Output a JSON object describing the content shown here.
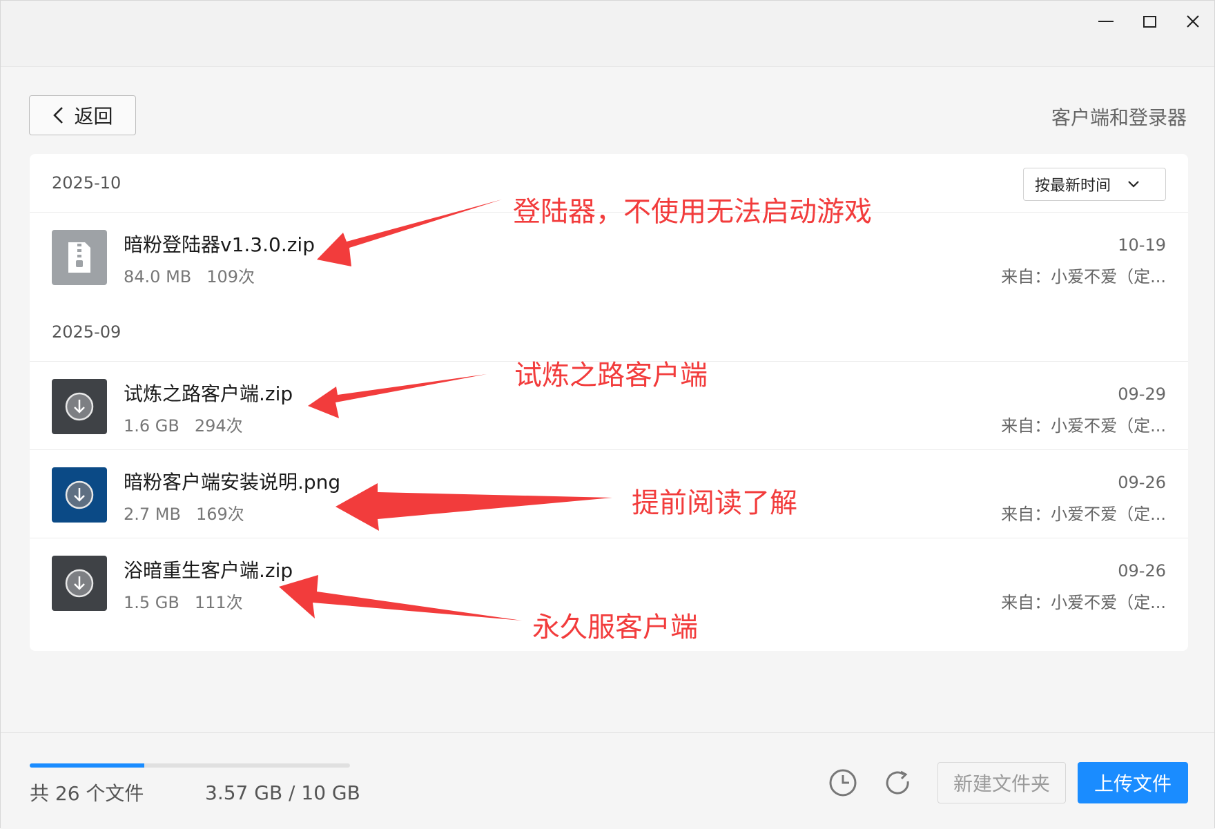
{
  "header": {
    "back_label": "返回",
    "folder_title": "客户端和登录器"
  },
  "sort": {
    "label": "按最新时间"
  },
  "groups": [
    {
      "month": "2025-10"
    },
    {
      "month": "2025-09"
    }
  ],
  "files": [
    {
      "name": "暗粉登陆器v1.3.0.zip",
      "size": "84.0 MB",
      "downloads": "109次",
      "date": "10-19",
      "from": "来自：小爱不爱（定...",
      "icon": "zip-file-icon"
    },
    {
      "name": "试炼之路客户端.zip",
      "size": "1.6 GB",
      "downloads": "294次",
      "date": "09-29",
      "from": "来自：小爱不爱（定...",
      "icon": "download-file-icon"
    },
    {
      "name": "暗粉客户端安装说明.png",
      "size": "2.7 MB",
      "downloads": "169次",
      "date": "09-26",
      "from": "来自：小爱不爱（定...",
      "icon": "image-file-icon"
    },
    {
      "name": "浴暗重生客户端.zip",
      "size": "1.5 GB",
      "downloads": "111次",
      "date": "09-26",
      "from": "来自：小爱不爱（定...",
      "icon": "download-file-icon"
    }
  ],
  "annotations": [
    "登陆器，不使用无法启动游戏",
    "试炼之路客户端",
    "提前阅读了解",
    "永久服客户端"
  ],
  "footer": {
    "file_count": "共 26 个文件",
    "storage": "3.57 GB / 10 GB",
    "storage_used_fraction": 0.357,
    "new_folder_label": "新建文件夹",
    "upload_label": "上传文件"
  },
  "colors": {
    "accent": "#1a8cff",
    "annotation": "#f23c3c"
  }
}
